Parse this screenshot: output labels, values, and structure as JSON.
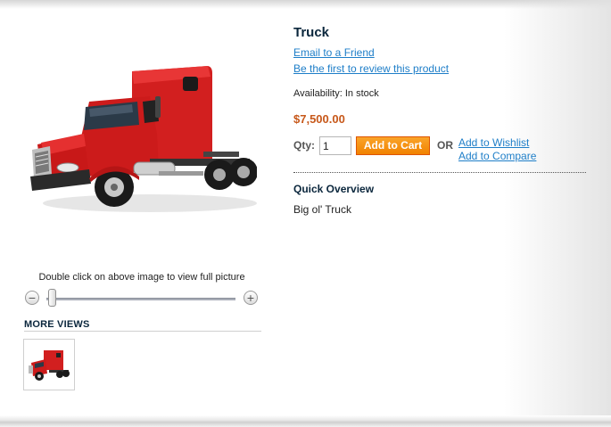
{
  "product": {
    "name": "Truck",
    "email_link": "Email to a Friend",
    "review_link": "Be the first to review this product",
    "availability": "Availability: In stock",
    "price": "$7,500.00",
    "qty_label": "Qty:",
    "qty_value": "1",
    "add_to_cart": "Add to Cart",
    "or_label": "OR",
    "wishlist_link": "Add to Wishlist",
    "compare_link": "Add to Compare",
    "overview_title": "Quick Overview",
    "description": "Big ol' Truck"
  },
  "gallery": {
    "zoom_hint": "Double click on above image to view full picture",
    "zoom_out_symbol": "−",
    "zoom_in_symbol": "+",
    "zoom_level": 0,
    "more_views_title": "MORE VIEWS"
  },
  "colors": {
    "price": "#c7581a",
    "link": "#1e7ec8",
    "heading": "#0a263c",
    "button_orange": "#f18200",
    "truck_red": "#d62020"
  },
  "icons": {
    "zoom_out": "minus-circle-icon",
    "zoom_in": "plus-circle-icon"
  }
}
